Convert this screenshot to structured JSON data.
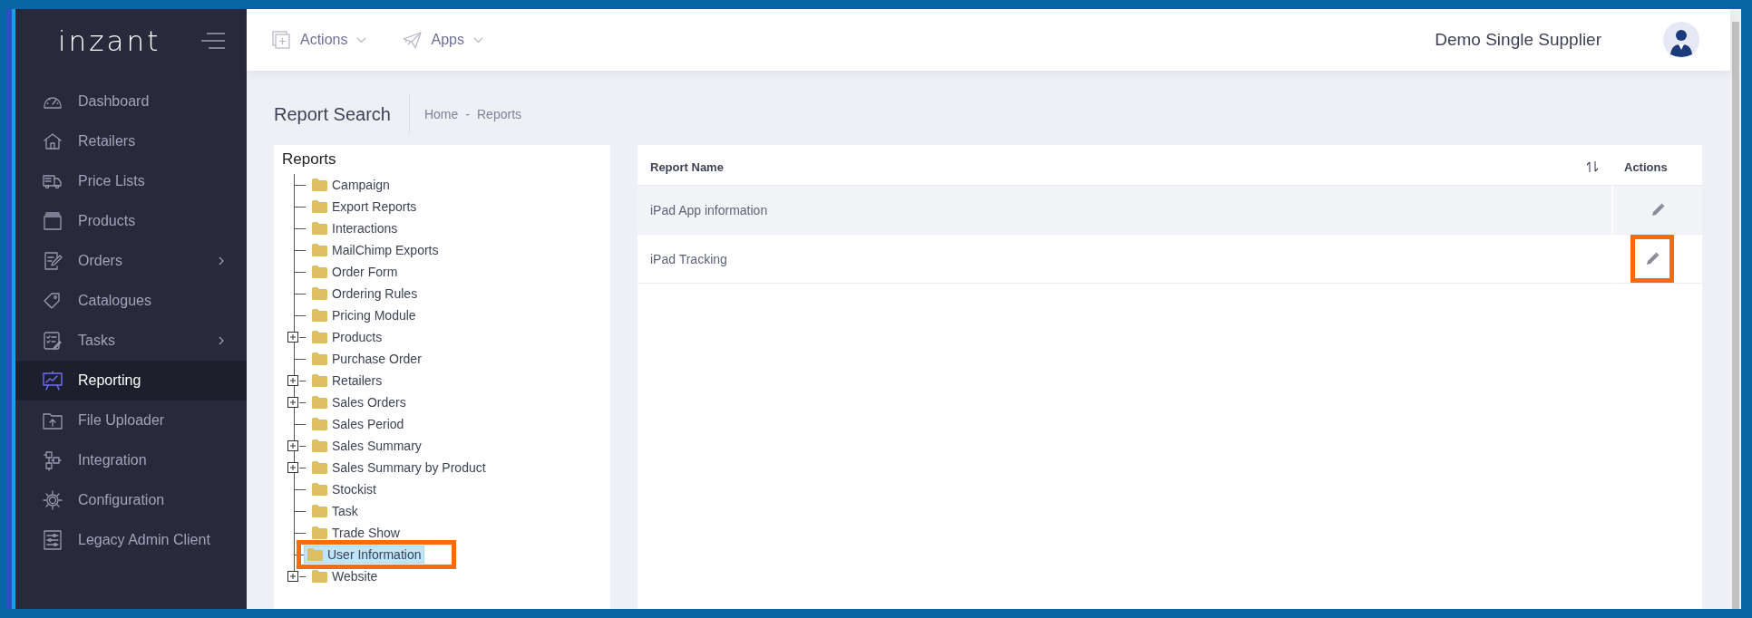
{
  "sidebar": {
    "logo": "inzant",
    "items": [
      {
        "label": "Dashboard",
        "selected": false,
        "has_submenu": false
      },
      {
        "label": "Retailers",
        "selected": false,
        "has_submenu": false
      },
      {
        "label": "Price Lists",
        "selected": false,
        "has_submenu": false
      },
      {
        "label": "Products",
        "selected": false,
        "has_submenu": false
      },
      {
        "label": "Orders",
        "selected": false,
        "has_submenu": true
      },
      {
        "label": "Catalogues",
        "selected": false,
        "has_submenu": false
      },
      {
        "label": "Tasks",
        "selected": false,
        "has_submenu": true
      },
      {
        "label": "Reporting",
        "selected": true,
        "has_submenu": false
      },
      {
        "label": "File Uploader",
        "selected": false,
        "has_submenu": false
      },
      {
        "label": "Integration",
        "selected": false,
        "has_submenu": false
      },
      {
        "label": "Configuration",
        "selected": false,
        "has_submenu": false
      },
      {
        "label": "Legacy Admin Client",
        "selected": false,
        "has_submenu": false
      }
    ]
  },
  "top_bar": {
    "menus": [
      {
        "label": "Actions"
      },
      {
        "label": "Apps"
      }
    ],
    "user_name": "Demo Single Supplier"
  },
  "page_header": {
    "title": "Report Search",
    "breadcrumb": [
      {
        "label": "Home"
      },
      {
        "label": "Reports"
      }
    ],
    "breadcrumb_separator": "-"
  },
  "tree": {
    "title": "Reports",
    "items": [
      {
        "label": "Campaign",
        "has_children": false,
        "selected": false,
        "highlighted": false
      },
      {
        "label": "Export Reports",
        "has_children": false,
        "selected": false,
        "highlighted": false
      },
      {
        "label": "Interactions",
        "has_children": false,
        "selected": false,
        "highlighted": false
      },
      {
        "label": "MailChimp Exports",
        "has_children": false,
        "selected": false,
        "highlighted": false
      },
      {
        "label": "Order Form",
        "has_children": false,
        "selected": false,
        "highlighted": false
      },
      {
        "label": "Ordering Rules",
        "has_children": false,
        "selected": false,
        "highlighted": false
      },
      {
        "label": "Pricing Module",
        "has_children": false,
        "selected": false,
        "highlighted": false
      },
      {
        "label": "Products",
        "has_children": true,
        "selected": false,
        "highlighted": false
      },
      {
        "label": "Purchase Order",
        "has_children": false,
        "selected": false,
        "highlighted": false
      },
      {
        "label": "Retailers",
        "has_children": true,
        "selected": false,
        "highlighted": false
      },
      {
        "label": "Sales Orders",
        "has_children": true,
        "selected": false,
        "highlighted": false
      },
      {
        "label": "Sales Period",
        "has_children": false,
        "selected": false,
        "highlighted": false
      },
      {
        "label": "Sales Summary",
        "has_children": true,
        "selected": false,
        "highlighted": false
      },
      {
        "label": "Sales Summary by Product",
        "has_children": true,
        "selected": false,
        "highlighted": false
      },
      {
        "label": "Stockist",
        "has_children": false,
        "selected": false,
        "highlighted": false
      },
      {
        "label": "Task",
        "has_children": false,
        "selected": false,
        "highlighted": false
      },
      {
        "label": "Trade Show",
        "has_children": false,
        "selected": false,
        "highlighted": false
      },
      {
        "label": "User Information",
        "has_children": false,
        "selected": true,
        "highlighted": true
      },
      {
        "label": "Website",
        "has_children": true,
        "selected": false,
        "highlighted": false
      }
    ]
  },
  "table": {
    "columns": [
      {
        "label": "Report Name",
        "sortable": true
      },
      {
        "label": "Actions",
        "sortable": false
      }
    ],
    "rows": [
      {
        "name": "iPad App information",
        "highlighted": false
      },
      {
        "name": "iPad Tracking",
        "highlighted": true
      }
    ]
  }
}
